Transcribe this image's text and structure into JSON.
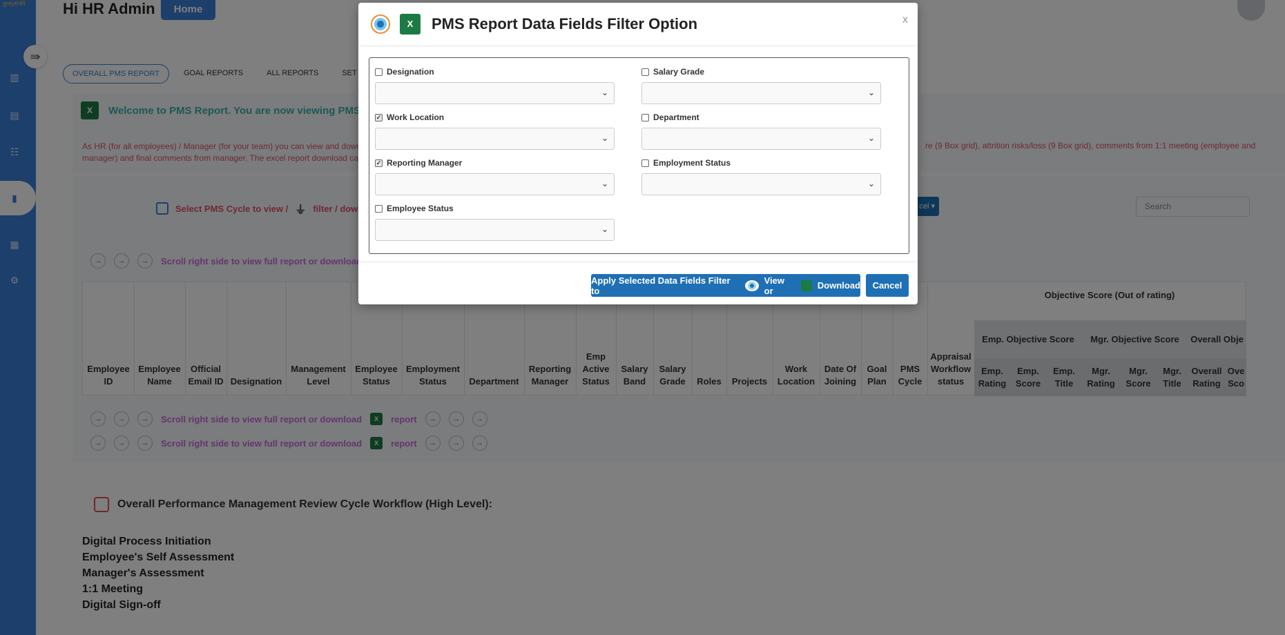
{
  "app": {
    "logo_text": "greytHR"
  },
  "header": {
    "greeting": "Hi HR Admin",
    "home_label": "Home"
  },
  "tabs": [
    {
      "label": "OVERALL PMS REPORT"
    },
    {
      "label": "GOAL REPORTS"
    },
    {
      "label": "ALL REPORTS"
    },
    {
      "label": "SET CUST"
    }
  ],
  "welcome": {
    "text": "Welcome to PMS Report. You are now viewing PMS cyc"
  },
  "description": {
    "left": "As HR (for all employees) / Manager (for your team) you can view and downlo",
    "left_line2": "manager) and final comments from manager. The excel report download can",
    "right": "re (9 Box grid), attrition risks/loss (9 Box grid), comments from 1:1 meeting (employee and"
  },
  "cycle": {
    "select_text": "Select PMS Cycle to view /",
    "filter_text": "filter / downlo"
  },
  "excel_dropdown": "cel",
  "search": {
    "placeholder": "Search"
  },
  "scroll_hint": {
    "text": "Scroll right side to view full report or download",
    "report": "report"
  },
  "table": {
    "columns": [
      "Employee ID",
      "Employee Name",
      "Official Email ID",
      "Designation",
      "Management Level",
      "Employee Status",
      "Employment Status",
      "Department",
      "Reporting Manager",
      "Emp Active Status",
      "Salary Band",
      "Salary Grade",
      "Roles",
      "Projects",
      "Work Location",
      "Date Of Joining",
      "Goal Plan",
      "PMS Cycle",
      "Appraisal Workflow status"
    ],
    "objective_header": "Objective Score (Out of rating)",
    "groups": [
      "Emp. Objective Score",
      "Mgr. Objective Score",
      "Overall Obje"
    ],
    "leaf_columns": [
      "Emp. Rating",
      "Emp. Score",
      "Emp. Title",
      "Mgr. Rating",
      "Mgr. Score",
      "Mgr. Title",
      "Overall Rating",
      "Ove Sco"
    ]
  },
  "workflow": {
    "title": "Overall Performance Management Review Cycle Workflow (High Level):",
    "steps": [
      "Digital Process Initiation",
      "Employee's Self Assessment",
      "Manager's Assessment",
      "1:1 Meeting",
      "Digital Sign-off"
    ]
  },
  "modal": {
    "title": "PMS Report Data Fields Filter Option",
    "close": "x",
    "fields": [
      {
        "label": "Designation",
        "checked": false
      },
      {
        "label": "Salary Grade",
        "checked": false
      },
      {
        "label": "Work Location",
        "checked": true
      },
      {
        "label": "Department",
        "checked": false
      },
      {
        "label": "Reporting Manager",
        "checked": true
      },
      {
        "label": "Employment Status",
        "checked": false
      },
      {
        "label": "Employee Status",
        "checked": false
      }
    ],
    "apply": {
      "prefix": "Apply Selected Data Fields Filter to",
      "view": "View or",
      "download": "Download"
    },
    "cancel": "Cancel"
  }
}
